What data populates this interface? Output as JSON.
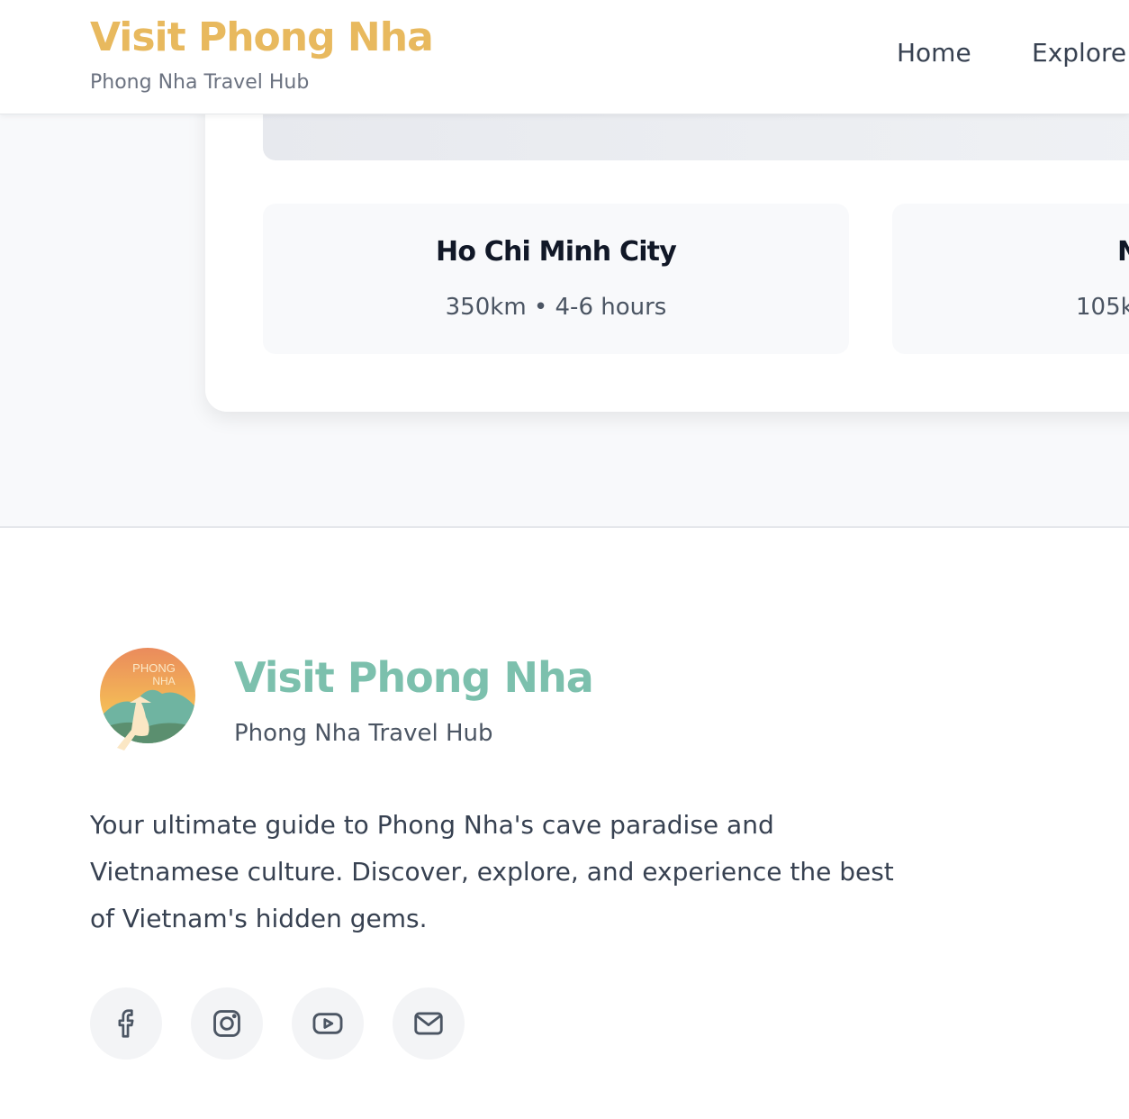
{
  "header": {
    "brand_title": "Visit Phong Nha",
    "brand_subtitle": "Phong Nha Travel Hub",
    "nav": [
      {
        "label": "Home"
      },
      {
        "label": "Explore"
      }
    ]
  },
  "destinations": [
    {
      "name": "Ho Chi Minh City",
      "meta": "350km • 4-6 hours"
    },
    {
      "name": "N",
      "meta": "105k"
    }
  ],
  "footer": {
    "logo_text": [
      "PHONG",
      "NHA"
    ],
    "title": "Visit Phong Nha",
    "subtitle": "Phong Nha Travel Hub",
    "description": "Your ultimate guide to Phong Nha's cave paradise and Vietnamese culture. Discover, explore, and experience the best of Vietnam's hidden gems.",
    "social": [
      {
        "icon": "facebook-icon"
      },
      {
        "icon": "instagram-icon"
      },
      {
        "icon": "youtube-icon"
      },
      {
        "icon": "mail-icon"
      }
    ]
  },
  "colors": {
    "header_brand": "#e8b95e",
    "footer_brand": "#7cc0ad",
    "page_bg": "#f8f9fb"
  }
}
